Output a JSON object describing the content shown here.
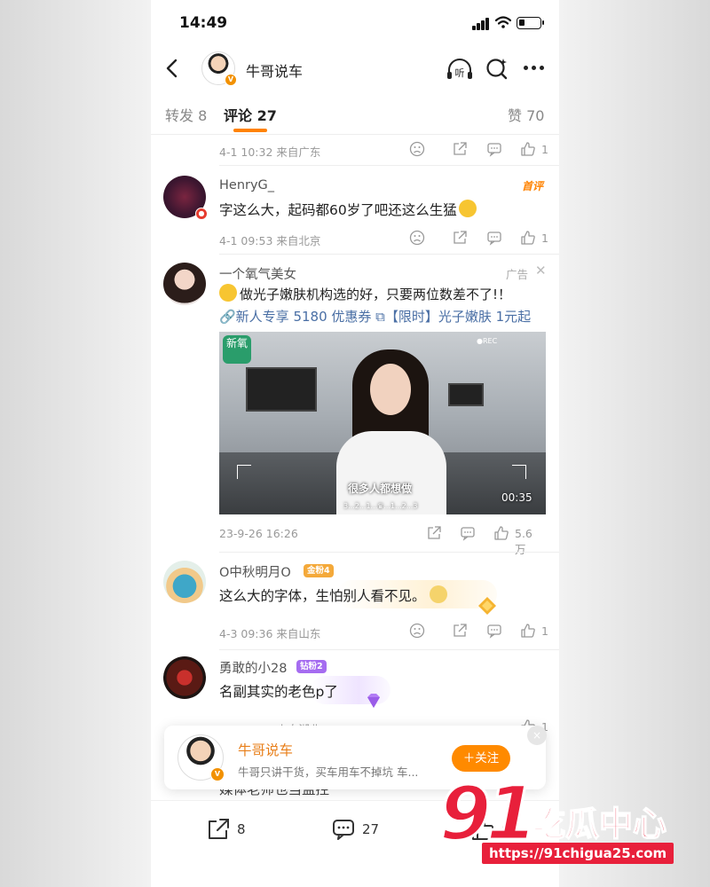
{
  "status_bar": {
    "time": "14:49"
  },
  "nav": {
    "title": "牛哥说车",
    "listen_label": "听"
  },
  "tabs": [
    {
      "label": "转发 8"
    },
    {
      "label": "评论 27"
    },
    {
      "label": "赞 70"
    }
  ],
  "top_meta": {
    "time_location": "4-1 10:32 来自广东",
    "like_count": "1"
  },
  "comments": [
    {
      "username": "HenryG_",
      "tag": "首评",
      "content": "字这么大，起码都60岁了吧还这么生猛",
      "time_location": "4-1 09:53 来自北京",
      "like_count": "1"
    },
    {
      "username": "一个氧气美女",
      "ad_label": "广告",
      "content": "做光子嫩肤机构选的好，只要两位数差不了!！",
      "links": "🔗新人专享 5180 优惠券 ⧉【限时】光子嫩肤 1元起",
      "video": {
        "logo": "新氧",
        "subtitle": "很多人都想做",
        "caption": "3...2...1...♛...1...2...3",
        "duration": "00:35",
        "rec": "●REC"
      },
      "time": "23-9-26 16:26",
      "like_count": "5.6万"
    },
    {
      "username": "O中秋明月O",
      "badge": "金粉4",
      "content": "这么大的字体，生怕别人看不见。",
      "time_location": "4-3 09:36 来自山东",
      "like_count": "1"
    },
    {
      "username": "勇敢的小28",
      "badge": "钻粉2",
      "content": "名副其实的老色p了",
      "time_location": "4-1 17:47 来自湖北",
      "like_count": "1"
    }
  ],
  "hidden_comment_fragment": "媒体老师也当监控",
  "follow_card": {
    "name": "牛哥说车",
    "description": "牛哥只讲干货，买车用车不掉坑 车...",
    "button": "＋关注",
    "close": "×"
  },
  "bottom_bar": {
    "repost_count": "8",
    "comment_count": "27",
    "like_count": "0"
  },
  "watermark": {
    "number": "91",
    "text": "吃瓜中心",
    "url": "https://91chigua25.com"
  },
  "colors": {
    "accent": "#ff8200",
    "link": "#4a6fa5",
    "watermark": "#e8203b"
  }
}
